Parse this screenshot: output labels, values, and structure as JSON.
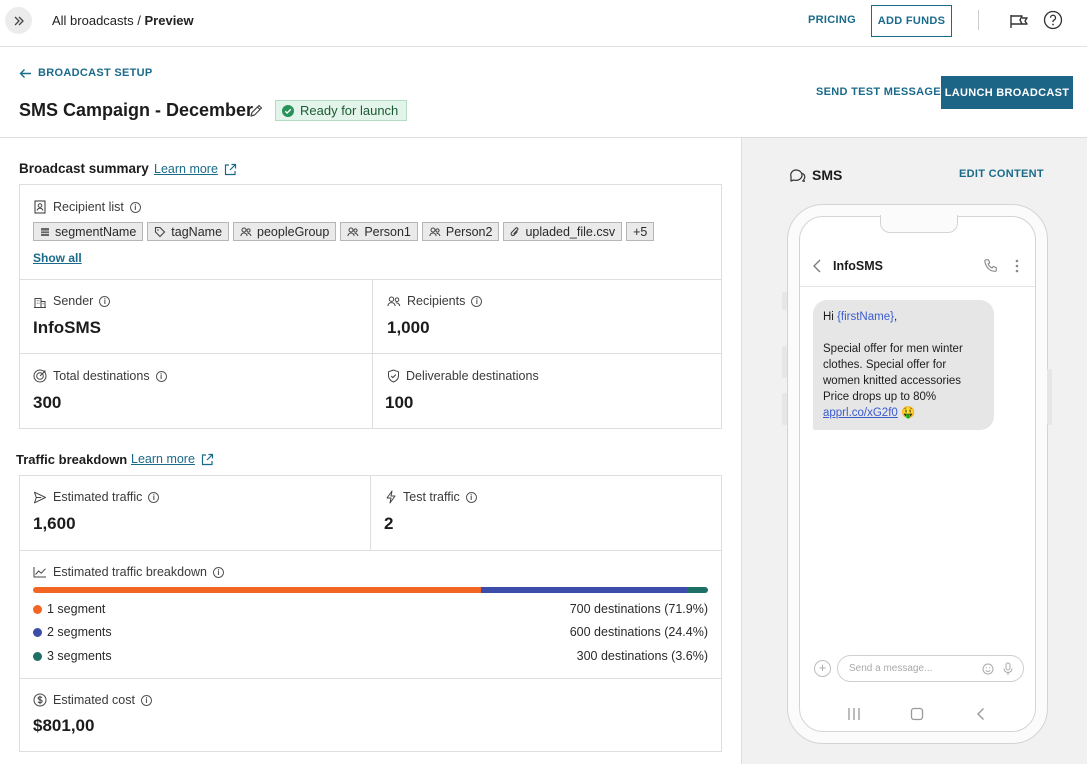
{
  "topbar": {
    "breadcrumb_parent": "All broadcasts",
    "breadcrumb_sep": " / ",
    "breadcrumb_current": "Preview",
    "pricing_label": "PRICING",
    "add_funds_label": "ADD FUNDS"
  },
  "header": {
    "back_label": "BROADCAST SETUP",
    "title": "SMS Campaign - December",
    "status": "Ready for launch",
    "send_test_label": "SEND TEST MESSAGE",
    "launch_label": "LAUNCH BROADCAST"
  },
  "summary": {
    "title": "Broadcast summary",
    "learn_more": "Learn more",
    "recipient_list_label": "Recipient list",
    "chips": [
      "segmentName",
      "tagName",
      "peopleGroup",
      "Person1",
      "Person2",
      "upladed_file.csv",
      "+5"
    ],
    "show_all": "Show all",
    "sender_label": "Sender",
    "sender_value": "InfoSMS",
    "recipients_label": "Recipients",
    "recipients_value": "1,000",
    "total_dest_label": "Total destinations",
    "total_dest_value": "300",
    "deliverable_label": "Deliverable destinations",
    "deliverable_value": "100"
  },
  "traffic": {
    "title": "Traffic breakdown",
    "learn_more": "Learn more",
    "estimated_label": "Estimated traffic",
    "estimated_value": "1,600",
    "test_label": "Test traffic",
    "test_value": "2",
    "breakdown_label": "Estimated traffic breakdown",
    "segments": [
      {
        "label": "1 segment",
        "value": "700 destinations (71.9%)",
        "share": 0.664,
        "color": "#f26522"
      },
      {
        "label": "2 segments",
        "value": "600 destinations (24.4%)",
        "share": 0.305,
        "color": "#3b4da8"
      },
      {
        "label": "3 segments",
        "value": "300 destinations (3.6%)",
        "share": 0.031,
        "color": "#1e6f66"
      }
    ],
    "cost_label": "Estimated cost",
    "cost_value": "$801,00"
  },
  "preview": {
    "title": "SMS",
    "edit_label": "EDIT CONTENT",
    "contact_name": "InfoSMS",
    "msg_hi": "Hi ",
    "msg_placeholder": "{firstName}",
    "msg_comma": ",",
    "msg_line1": "Special offer for men winter clothes. Special offer for women knitted accessories",
    "msg_line2": "Price drops up to 80%",
    "msg_link": "apprl.co/xG2f0",
    "msg_emoji": "🤑",
    "compose_placeholder": "Send a message..."
  }
}
